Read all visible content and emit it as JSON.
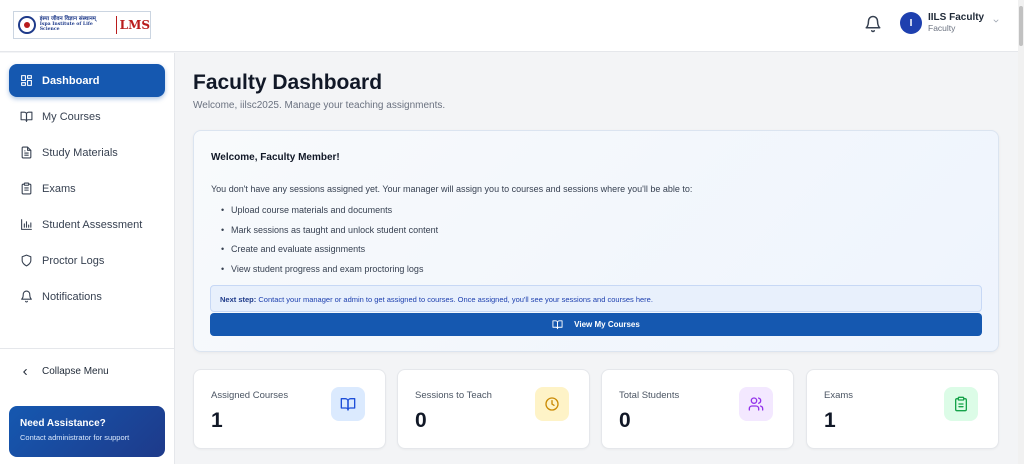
{
  "header": {
    "logo": {
      "line1": "इंस्पा जीवन विज्ञान संस्थानम्",
      "line2": "Ispa Institute of Life Science",
      "lms": "LMS"
    },
    "user": {
      "initial": "I",
      "name": "IILS Faculty",
      "role": "Faculty"
    }
  },
  "sidebar": {
    "items": [
      {
        "label": "Dashboard",
        "icon": "dashboard-grid-icon",
        "active": true
      },
      {
        "label": "My Courses",
        "icon": "book-open-icon"
      },
      {
        "label": "Study Materials",
        "icon": "file-text-icon"
      },
      {
        "label": "Exams",
        "icon": "clipboard-icon"
      },
      {
        "label": "Student Assessment",
        "icon": "bar-chart-icon"
      },
      {
        "label": "Proctor Logs",
        "icon": "shield-icon"
      },
      {
        "label": "Notifications",
        "icon": "bell-icon"
      }
    ],
    "collapse_label": "Collapse Menu",
    "assist": {
      "title": "Need Assistance?",
      "subtitle": "Contact administrator for support"
    }
  },
  "main": {
    "title": "Faculty Dashboard",
    "subtitle": "Welcome, iilsc2025. Manage your teaching assignments.",
    "welcome_card": {
      "title": "Welcome, Faculty Member!",
      "intro": "You don't have any sessions assigned yet. Your manager will assign you to courses and sessions where you'll be able to:",
      "bullets": [
        "Upload course materials and documents",
        "Mark sessions as taught and unlock student content",
        "Create and evaluate assignments",
        "View student progress and exam proctoring logs"
      ],
      "next_step_label": "Next step:",
      "next_step_text": "Contact your manager or admin to get assigned to courses. Once assigned, you'll see your sessions and courses here.",
      "button_label": "View My Courses"
    },
    "stats": [
      {
        "label": "Assigned Courses",
        "value": "1",
        "icon": "book-icon",
        "bg": "#dbeafe",
        "color": "#1d4ed8"
      },
      {
        "label": "Sessions to Teach",
        "value": "0",
        "icon": "clock-icon",
        "bg": "#fef3c7",
        "color": "#ca8a04"
      },
      {
        "label": "Total Students",
        "value": "0",
        "icon": "users-icon",
        "bg": "#f3e8ff",
        "color": "#9333ea"
      },
      {
        "label": "Exams",
        "value": "1",
        "icon": "clipboard-check-icon",
        "bg": "#dcfce7",
        "color": "#16a34a"
      }
    ]
  }
}
